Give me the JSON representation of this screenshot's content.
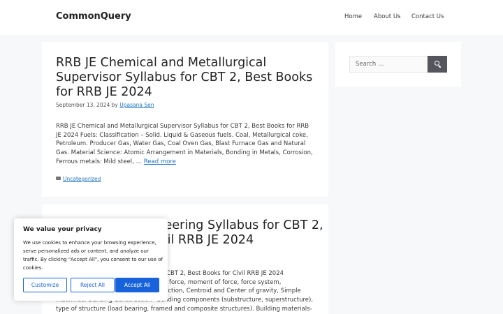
{
  "site": {
    "name": "CommonQuery",
    "nav": [
      "Home",
      "About Us",
      "Contact Us"
    ]
  },
  "posts": [
    {
      "title": "RRB JE Chemical and Metallurgical Supervisor Syllabus for CBT 2, Best Books for RRB JE 2024",
      "date": "September 13, 2024",
      "by": "by",
      "author": "Upasana Sen",
      "excerpt": "RRB JE Chemical and Metallurgical Supervisor Syllabus for CBT 2, Best Books for RRB JE 2024 Fuels: Classification – Solid. Liquid & Gaseous fuels. Coal, Metallurgical coke, Petroleum. Producer Gas, Water Gas, Coal Oven Gas, Blast Furnace Gas and Natural Gas. Material Science: Atomic Arrangement in Materials, Bonding in Metals, Corrosion, Ferrous metals: Mild steel, …",
      "read_more": "Read more",
      "category": "Uncategorized"
    },
    {
      "title": "RRB JE Civil Engineering Syllabus for CBT 2, Best Books for Civil RRB JE 2024",
      "excerpt": "RRB JE Civil Engineering Syllabus for CBT 2, Best Books for Civil RRB JE 2024 Engineering Mechanics: Resolution of force, moment of force, force system, composition of forces, Equilibrium, Friction, Centroid and Center of gravity, Simple machines. Building Construction– Building components (substructure, superstructure), type of structure (load bearing, framed and composite structures). Building materials-"
    }
  ],
  "sidebar": {
    "search_placeholder": "Search …"
  },
  "privacy": {
    "title": "We value your privacy",
    "text": "We use cookies to enhance your browsing experience, serve personalized ads or content, and analyze our traffic. By clicking \"Accept All\", you consent to our use of cookies.",
    "customize": "Customize",
    "reject": "Reject All",
    "accept": "Accept All"
  },
  "colors": {
    "link": "#1e73be",
    "accent": "#1863dc",
    "search_button": "#55555e"
  }
}
